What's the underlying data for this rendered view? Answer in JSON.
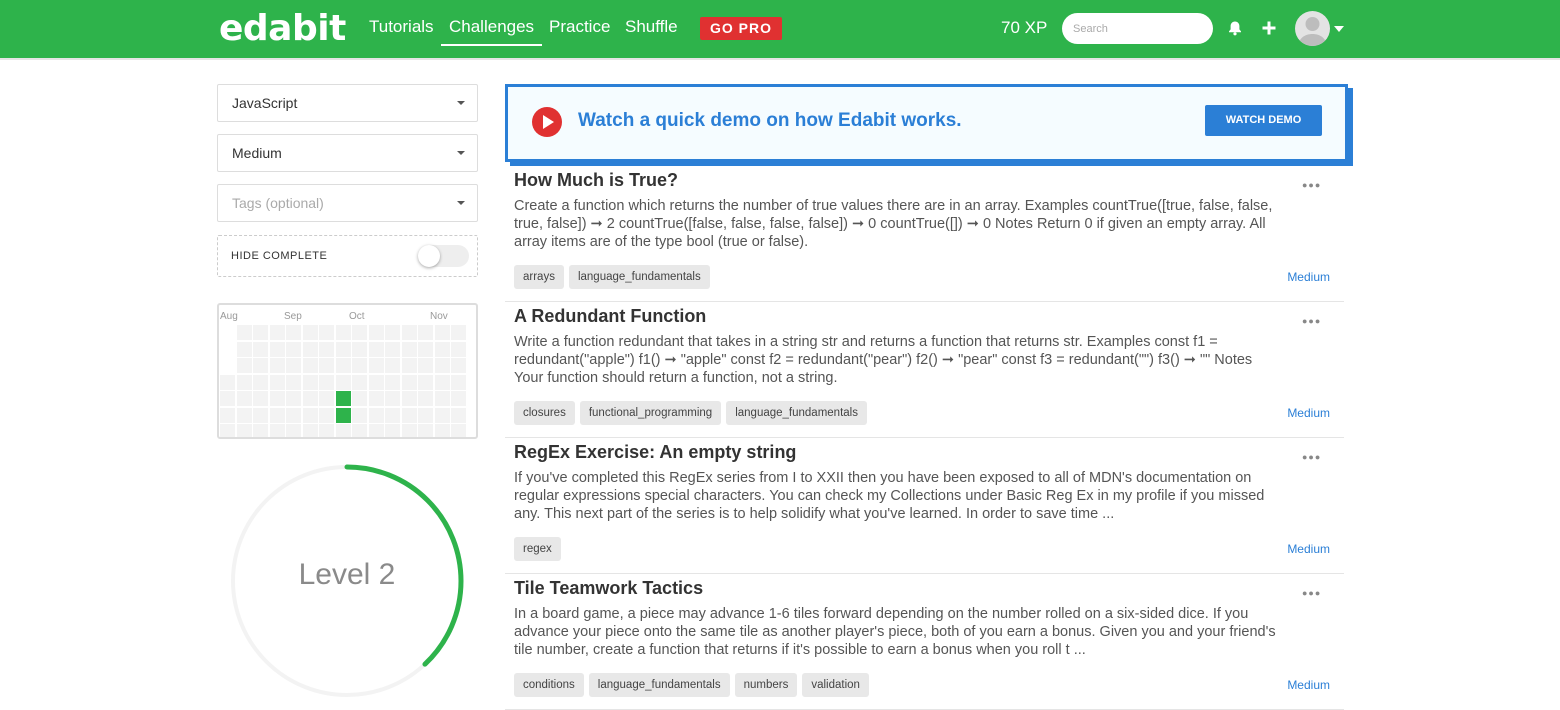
{
  "header": {
    "logo": "edabit",
    "nav": [
      "Tutorials",
      "Challenges",
      "Practice",
      "Shuffle"
    ],
    "active_nav": "Challenges",
    "go_pro": "GO PRO",
    "xp": "70 XP",
    "search_placeholder": "Search",
    "icons": [
      "bell-icon",
      "plus-icon",
      "user-avatar",
      "caret-down-icon"
    ]
  },
  "sidebar": {
    "language": "JavaScript",
    "difficulty": "Medium",
    "tags_placeholder": "Tags (optional)",
    "hide_complete_label": "HIDE COMPLETE",
    "hide_complete_on": false,
    "heatmap_months": [
      "Aug",
      "Sep",
      "Oct",
      "Nov"
    ],
    "level_label": "Level 2",
    "level_progress_fraction": 0.38
  },
  "demo": {
    "text": "Watch a quick demo on how Edabit works.",
    "button": "WATCH DEMO"
  },
  "challenges": [
    {
      "title": "How Much is True?",
      "description": "Create a function which returns the number of true values there are in an array. Examples countTrue([true, false, false, true, false]) ➞ 2 countTrue([false, false, false, false]) ➞ 0 countTrue([]) ➞ 0 Notes Return 0 if given an empty array. All array items are of the type bool (true or false).",
      "tags": [
        "arrays",
        "language_fundamentals"
      ],
      "difficulty": "Medium"
    },
    {
      "title": "A Redundant Function",
      "description": "Write a function redundant that takes in a string str and returns a function that returns str. Examples const f1 = redundant(\"apple\") f1() ➞ \"apple\" const f2 = redundant(\"pear\") f2() ➞ \"pear\" const f3 = redundant(\"\") f3() ➞ \"\" Notes Your function should return a function, not a string.",
      "tags": [
        "closures",
        "functional_programming",
        "language_fundamentals"
      ],
      "difficulty": "Medium"
    },
    {
      "title": "RegEx Exercise: An empty string",
      "description": "If you've completed this RegEx series from I to XXII then you have been exposed to all of MDN's documentation on regular expressions special characters. You can check my Collections under Basic Reg Ex in my profile if you missed any. This next part of the series is to help solidify what you've learned. In order to save time ...",
      "tags": [
        "regex"
      ],
      "difficulty": "Medium"
    },
    {
      "title": "Tile Teamwork Tactics",
      "description": "In a board game, a piece may advance 1-6 tiles forward depending on the number rolled on a six-sided dice. If you advance your piece onto the same tile as another player's piece, both of you earn a bonus. Given you and your friend's tile number, create a function that returns if it's possible to earn a bonus when you roll t ...",
      "tags": [
        "conditions",
        "language_fundamentals",
        "numbers",
        "validation"
      ],
      "difficulty": "Medium"
    }
  ],
  "colors": {
    "brand_green": "#2eb34b",
    "pro_red": "#e03131",
    "link_blue": "#2b7fd6"
  }
}
